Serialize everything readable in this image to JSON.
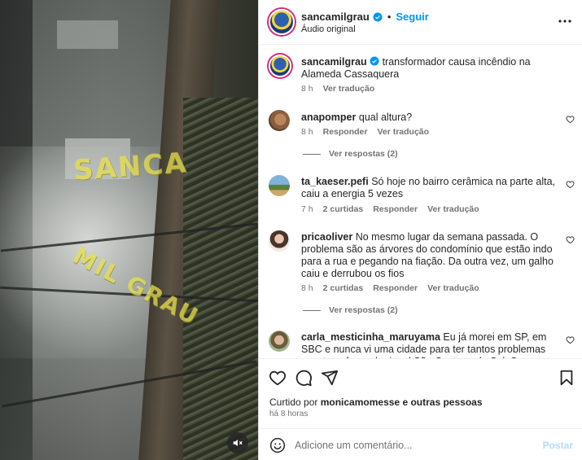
{
  "header": {
    "username": "sancamilgrau",
    "separator": "•",
    "follow_label": "Seguir",
    "subtitle": "Áudio original"
  },
  "caption": {
    "username": "sancamilgrau",
    "text": "transformador causa incêndio na Alameda Cassaquera",
    "time": "8 h",
    "translate": "Ver tradução"
  },
  "media": {
    "watermark_top": "SANCA",
    "watermark_bottom": "MIL GRAU"
  },
  "comments": [
    {
      "username": "anapomper",
      "text": "qual altura?",
      "time": "8 h",
      "likes": "",
      "reply": "Responder",
      "translate": "Ver tradução",
      "view_replies": "Ver respostas (2)"
    },
    {
      "username": "ta_kaeser.pefi",
      "text": "Só hoje no bairro cerâmica na parte alta, caiu a energia 5 vezes",
      "time": "7 h",
      "likes": "2 curtidas",
      "reply": "Responder",
      "translate": "Ver tradução",
      "view_replies": ""
    },
    {
      "username": "pricaoliver",
      "text": "No mesmo lugar da semana passada. O problema são as árvores do condomínio que estão indo para a rua e pegando na fiação. Da outra vez, um galho caiu e derrubou os fios",
      "time": "8 h",
      "likes": "2 curtidas",
      "reply": "Responder",
      "translate": "Ver tradução",
      "view_replies": "Ver respostas (2)"
    },
    {
      "username": "carla_mesticinha_maruyama",
      "text": "Eu já morei em SP, em SBC e nunca vi uma cidade para ter tantos problemas com transformador igual São Caetano do Sul. Sempre algum",
      "time": "",
      "likes": "",
      "reply": "",
      "translate": "",
      "view_replies": ""
    }
  ],
  "actions": {
    "liked_prefix": "Curtido por",
    "liked_user": "monicamomesse",
    "liked_suffix": "e outras pessoas",
    "time": "há 8 horas"
  },
  "composer": {
    "placeholder": "Adicione um comentário...",
    "post_label": "Postar"
  }
}
